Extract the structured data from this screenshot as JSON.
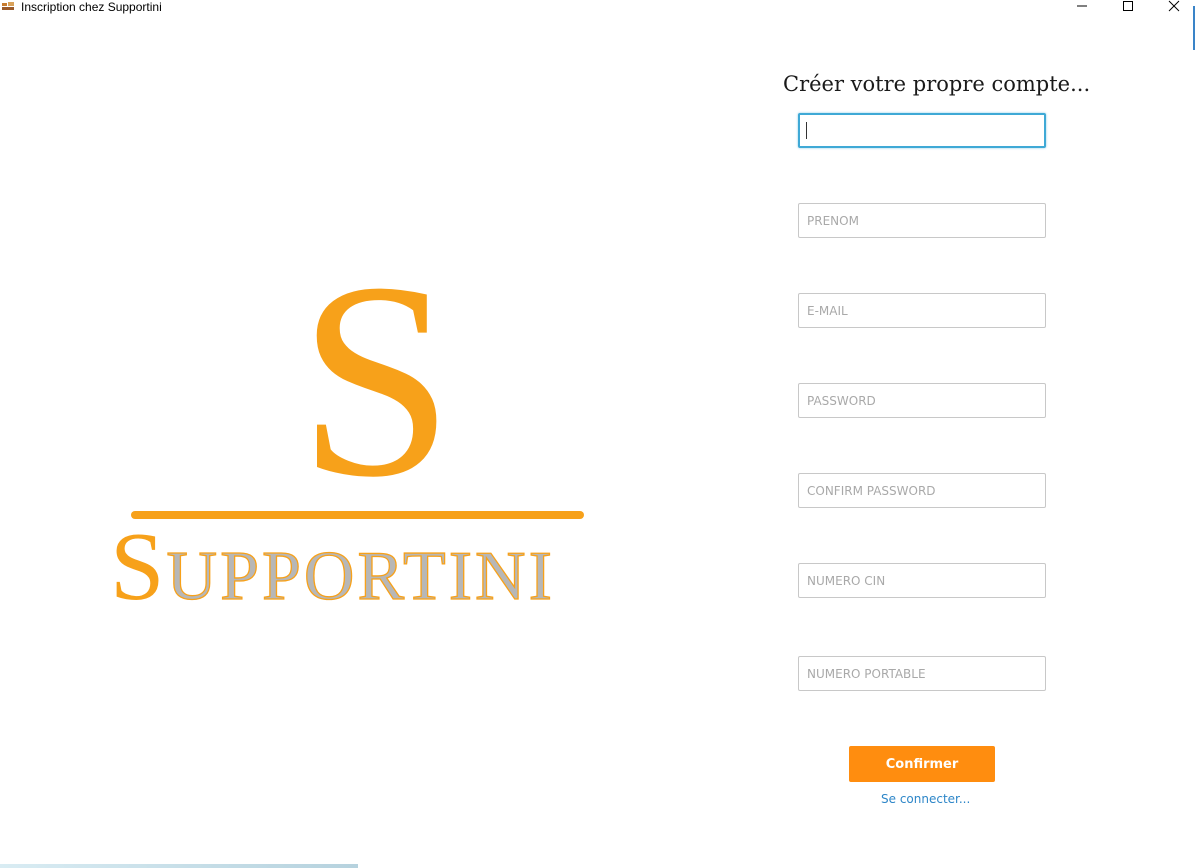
{
  "window": {
    "title": "Inscription chez Supportini",
    "controls": [
      "minimize-icon",
      "maximize-icon",
      "close-icon"
    ]
  },
  "logo": {
    "big_letter": "S",
    "word_initial": "S",
    "word_rest": "UPPORTINI",
    "primary_color": "#f7a11a",
    "secondary_color": "#b7b7b7"
  },
  "form": {
    "title": "Créer votre propre compte...",
    "fields": [
      {
        "name": "nom",
        "placeholder": "",
        "value": ""
      },
      {
        "name": "prenom",
        "placeholder": "PRENOM",
        "value": ""
      },
      {
        "name": "email",
        "placeholder": "E-MAIL",
        "value": ""
      },
      {
        "name": "password",
        "placeholder": "PASSWORD",
        "value": ""
      },
      {
        "name": "confirm_password",
        "placeholder": "CONFIRM PASSWORD",
        "value": ""
      },
      {
        "name": "numero_cin",
        "placeholder": "NUMERO CIN",
        "value": ""
      },
      {
        "name": "numero_portable",
        "placeholder": "NUMERO PORTABLE",
        "value": ""
      }
    ],
    "confirm_label": "Confirmer",
    "login_link": "Se connecter..."
  },
  "colors": {
    "accent": "#ff8d0f",
    "focus_border": "#3fa9d6",
    "link": "#2d86c8"
  }
}
